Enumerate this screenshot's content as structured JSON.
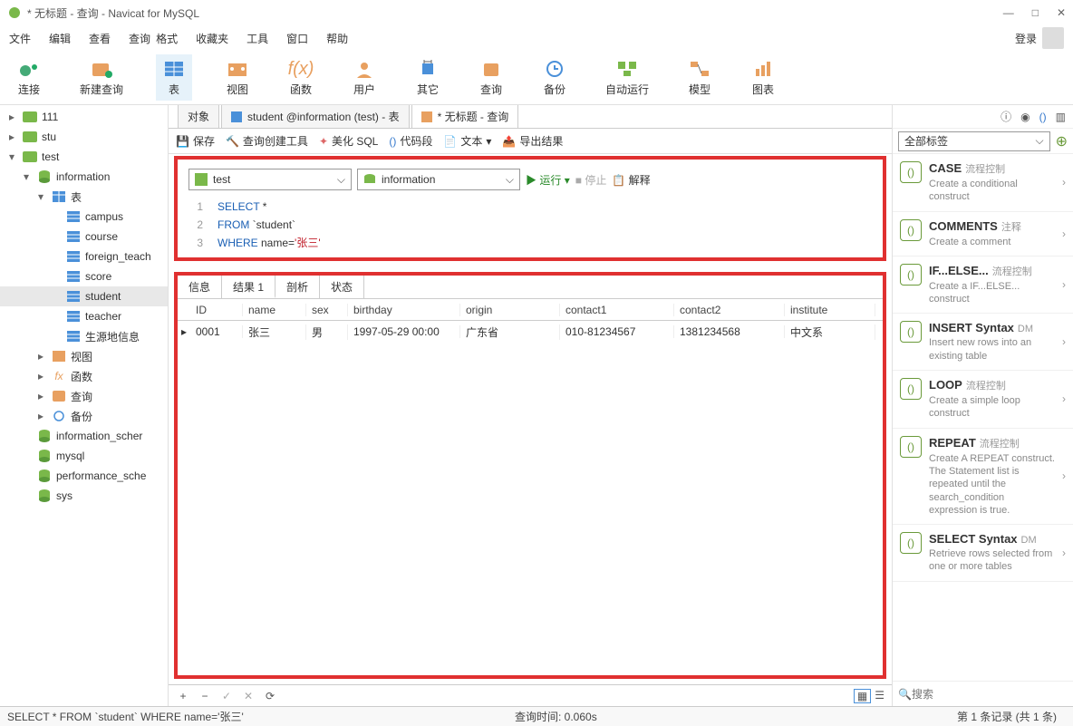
{
  "window": {
    "title": "* 无标题 - 查询 - Navicat for MySQL"
  },
  "menus": [
    "文件",
    "编辑",
    "查看",
    "查询",
    "格式",
    "收藏夹",
    "工具",
    "窗口",
    "帮助"
  ],
  "login_label": "登录",
  "main_tools": [
    {
      "label": "连接",
      "icon": "connect"
    },
    {
      "label": "新建查询",
      "icon": "newquery"
    },
    {
      "label": "表",
      "icon": "table",
      "active": true
    },
    {
      "label": "视图",
      "icon": "view"
    },
    {
      "label": "函数",
      "icon": "fx"
    },
    {
      "label": "用户",
      "icon": "user"
    },
    {
      "label": "其它",
      "icon": "other"
    },
    {
      "label": "查询",
      "icon": "query"
    },
    {
      "label": "备份",
      "icon": "backup"
    },
    {
      "label": "自动运行",
      "icon": "auto"
    },
    {
      "label": "模型",
      "icon": "model"
    },
    {
      "label": "图表",
      "icon": "chart"
    }
  ],
  "tree": [
    {
      "label": "111",
      "indent": 0,
      "icon": "conn",
      "exp": "▸"
    },
    {
      "label": "stu",
      "indent": 0,
      "icon": "conn",
      "exp": "▸"
    },
    {
      "label": "test",
      "indent": 0,
      "icon": "conn",
      "exp": "▾"
    },
    {
      "label": "information",
      "indent": 1,
      "icon": "db",
      "exp": "▾"
    },
    {
      "label": "表",
      "indent": 2,
      "icon": "tables",
      "exp": "▾"
    },
    {
      "label": "campus",
      "indent": 3,
      "icon": "table"
    },
    {
      "label": "course",
      "indent": 3,
      "icon": "table"
    },
    {
      "label": "foreign_teach",
      "indent": 3,
      "icon": "table"
    },
    {
      "label": "score",
      "indent": 3,
      "icon": "table"
    },
    {
      "label": "student",
      "indent": 3,
      "icon": "table",
      "selected": true
    },
    {
      "label": "teacher",
      "indent": 3,
      "icon": "table"
    },
    {
      "label": "生源地信息",
      "indent": 3,
      "icon": "table"
    },
    {
      "label": "视图",
      "indent": 2,
      "icon": "view",
      "exp": "▸"
    },
    {
      "label": "函数",
      "indent": 2,
      "icon": "fx",
      "exp": "▸"
    },
    {
      "label": "查询",
      "indent": 2,
      "icon": "query",
      "exp": "▸"
    },
    {
      "label": "备份",
      "indent": 2,
      "icon": "backup",
      "exp": "▸"
    },
    {
      "label": "information_scher",
      "indent": 1,
      "icon": "db"
    },
    {
      "label": "mysql",
      "indent": 1,
      "icon": "db"
    },
    {
      "label": "performance_sche",
      "indent": 1,
      "icon": "db"
    },
    {
      "label": "sys",
      "indent": 1,
      "icon": "db"
    }
  ],
  "tabs": [
    {
      "label": "对象"
    },
    {
      "label": "student @information (test) - 表"
    },
    {
      "label": "* 无标题 - 查询",
      "active": true
    }
  ],
  "subtools": [
    "保存",
    "查询创建工具",
    "美化 SQL",
    "代码段",
    "文本",
    "导出结果"
  ],
  "combos": {
    "conn": "test",
    "db": "information"
  },
  "actions": {
    "run": "运行",
    "stop": "停止",
    "explain": "解释"
  },
  "sql": {
    "l1a": "SELECT",
    "l1b": " *",
    "l2a": "FROM",
    "l2b": " `student`",
    "l3a": "WHERE",
    "l3b": " name=",
    "l3c": "'张三'"
  },
  "result_tabs": [
    "信息",
    "结果 1",
    "剖析",
    "状态"
  ],
  "grid": {
    "headers": [
      "ID",
      "name",
      "sex",
      "birthday",
      "origin",
      "contact1",
      "contact2",
      "institute"
    ],
    "row": [
      "0001",
      "张三",
      "男",
      "1997-05-29 00:00",
      "广东省",
      "010-81234567",
      "1381234568",
      "中文系"
    ]
  },
  "status": {
    "sql": "SELECT *  FROM `student` WHERE name='张三'",
    "time": "查询时间: 0.060s",
    "rec": "第 1 条记录  (共 1 条)"
  },
  "rp_filter": "全部标签",
  "rp_items": [
    {
      "title": "CASE",
      "tag": "流程控制",
      "desc": "Create a conditional construct"
    },
    {
      "title": "COMMENTS",
      "tag": "注释",
      "desc": "Create a comment"
    },
    {
      "title": "IF...ELSE...",
      "tag": "流程控制",
      "desc": "Create a IF...ELSE... construct"
    },
    {
      "title": "INSERT Syntax",
      "tag": "DM",
      "desc": "Insert new rows into an existing table"
    },
    {
      "title": "LOOP",
      "tag": "流程控制",
      "desc": "Create a simple loop construct"
    },
    {
      "title": "REPEAT",
      "tag": "流程控制",
      "desc": "Create A REPEAT construct. The Statement list is repeated until the search_condition expression is true."
    },
    {
      "title": "SELECT Syntax",
      "tag": "DM",
      "desc": "Retrieve rows selected from one or more tables"
    }
  ],
  "rp_search_placeholder": "搜索"
}
